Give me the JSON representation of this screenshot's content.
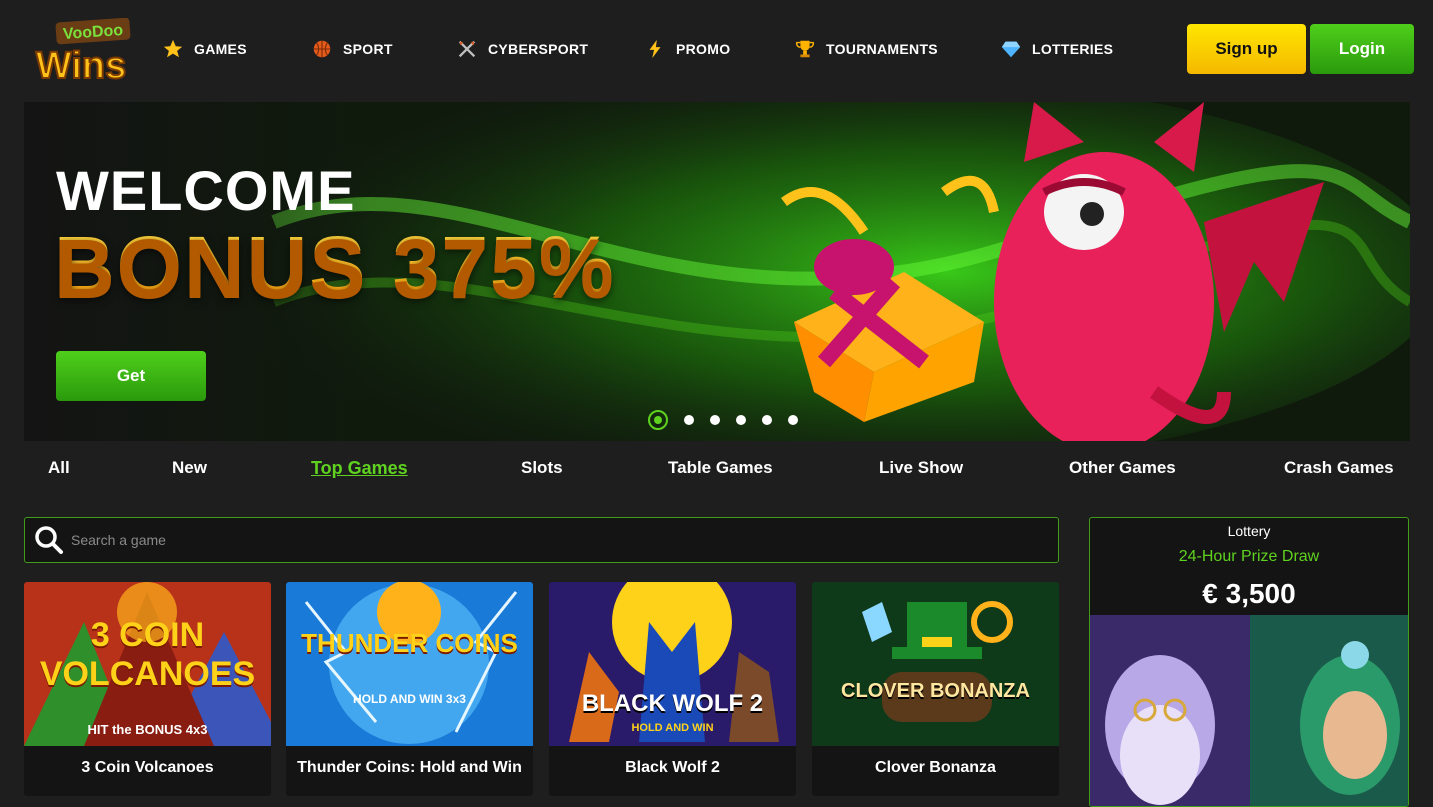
{
  "header": {
    "logo_text_top": "VooDoo",
    "logo_text_bottom": "Wins",
    "nav": [
      {
        "label": "GAMES",
        "icon": "star-icon"
      },
      {
        "label": "SPORT",
        "icon": "basketball-icon"
      },
      {
        "label": "CYBERSPORT",
        "icon": "crossed-swords-icon"
      },
      {
        "label": "PROMO",
        "icon": "lightning-icon"
      },
      {
        "label": "TOURNAMENTS",
        "icon": "trophy-icon"
      },
      {
        "label": "LOTTERIES",
        "icon": "diamond-icon"
      }
    ],
    "signup_label": "Sign up",
    "login_label": "Login"
  },
  "banner": {
    "welcome": "WELCOME",
    "bonus": "BONUS 375%",
    "get_label": "Get",
    "slides_total": 6,
    "active_slide": 1
  },
  "tabs": [
    {
      "label": "All",
      "active": false
    },
    {
      "label": "New",
      "active": false
    },
    {
      "label": "Top Games",
      "active": true
    },
    {
      "label": "Slots",
      "active": false
    },
    {
      "label": "Table Games",
      "active": false
    },
    {
      "label": "Live Show",
      "active": false
    },
    {
      "label": "Other Games",
      "active": false
    },
    {
      "label": "Crash Games",
      "active": false
    }
  ],
  "search": {
    "placeholder": "Search a game"
  },
  "games": [
    {
      "name": "3 Coin Volcanoes",
      "art_title": "3 COIN VOLCANOES",
      "art_sub": "HIT the BONUS 4x3"
    },
    {
      "name": "Thunder Coins: Hold and Win",
      "art_title": "THUNDER COINS",
      "art_sub": "HOLD AND WIN 3x3"
    },
    {
      "name": "Black Wolf 2",
      "art_title": "BLACK WOLF 2",
      "art_sub": "HOLD AND WIN"
    },
    {
      "name": "Clover Bonanza",
      "art_title": "CLOVER BONANZA",
      "art_sub": ""
    }
  ],
  "lottery": {
    "label": "Lottery",
    "title": "24-Hour Prize Draw",
    "prize": "€ 3,500"
  },
  "colors": {
    "accent_green": "#5fd21f",
    "signup_yellow": "#ffd400",
    "bonus_orange": "#ff9f00",
    "background": "#1e1e1f"
  }
}
